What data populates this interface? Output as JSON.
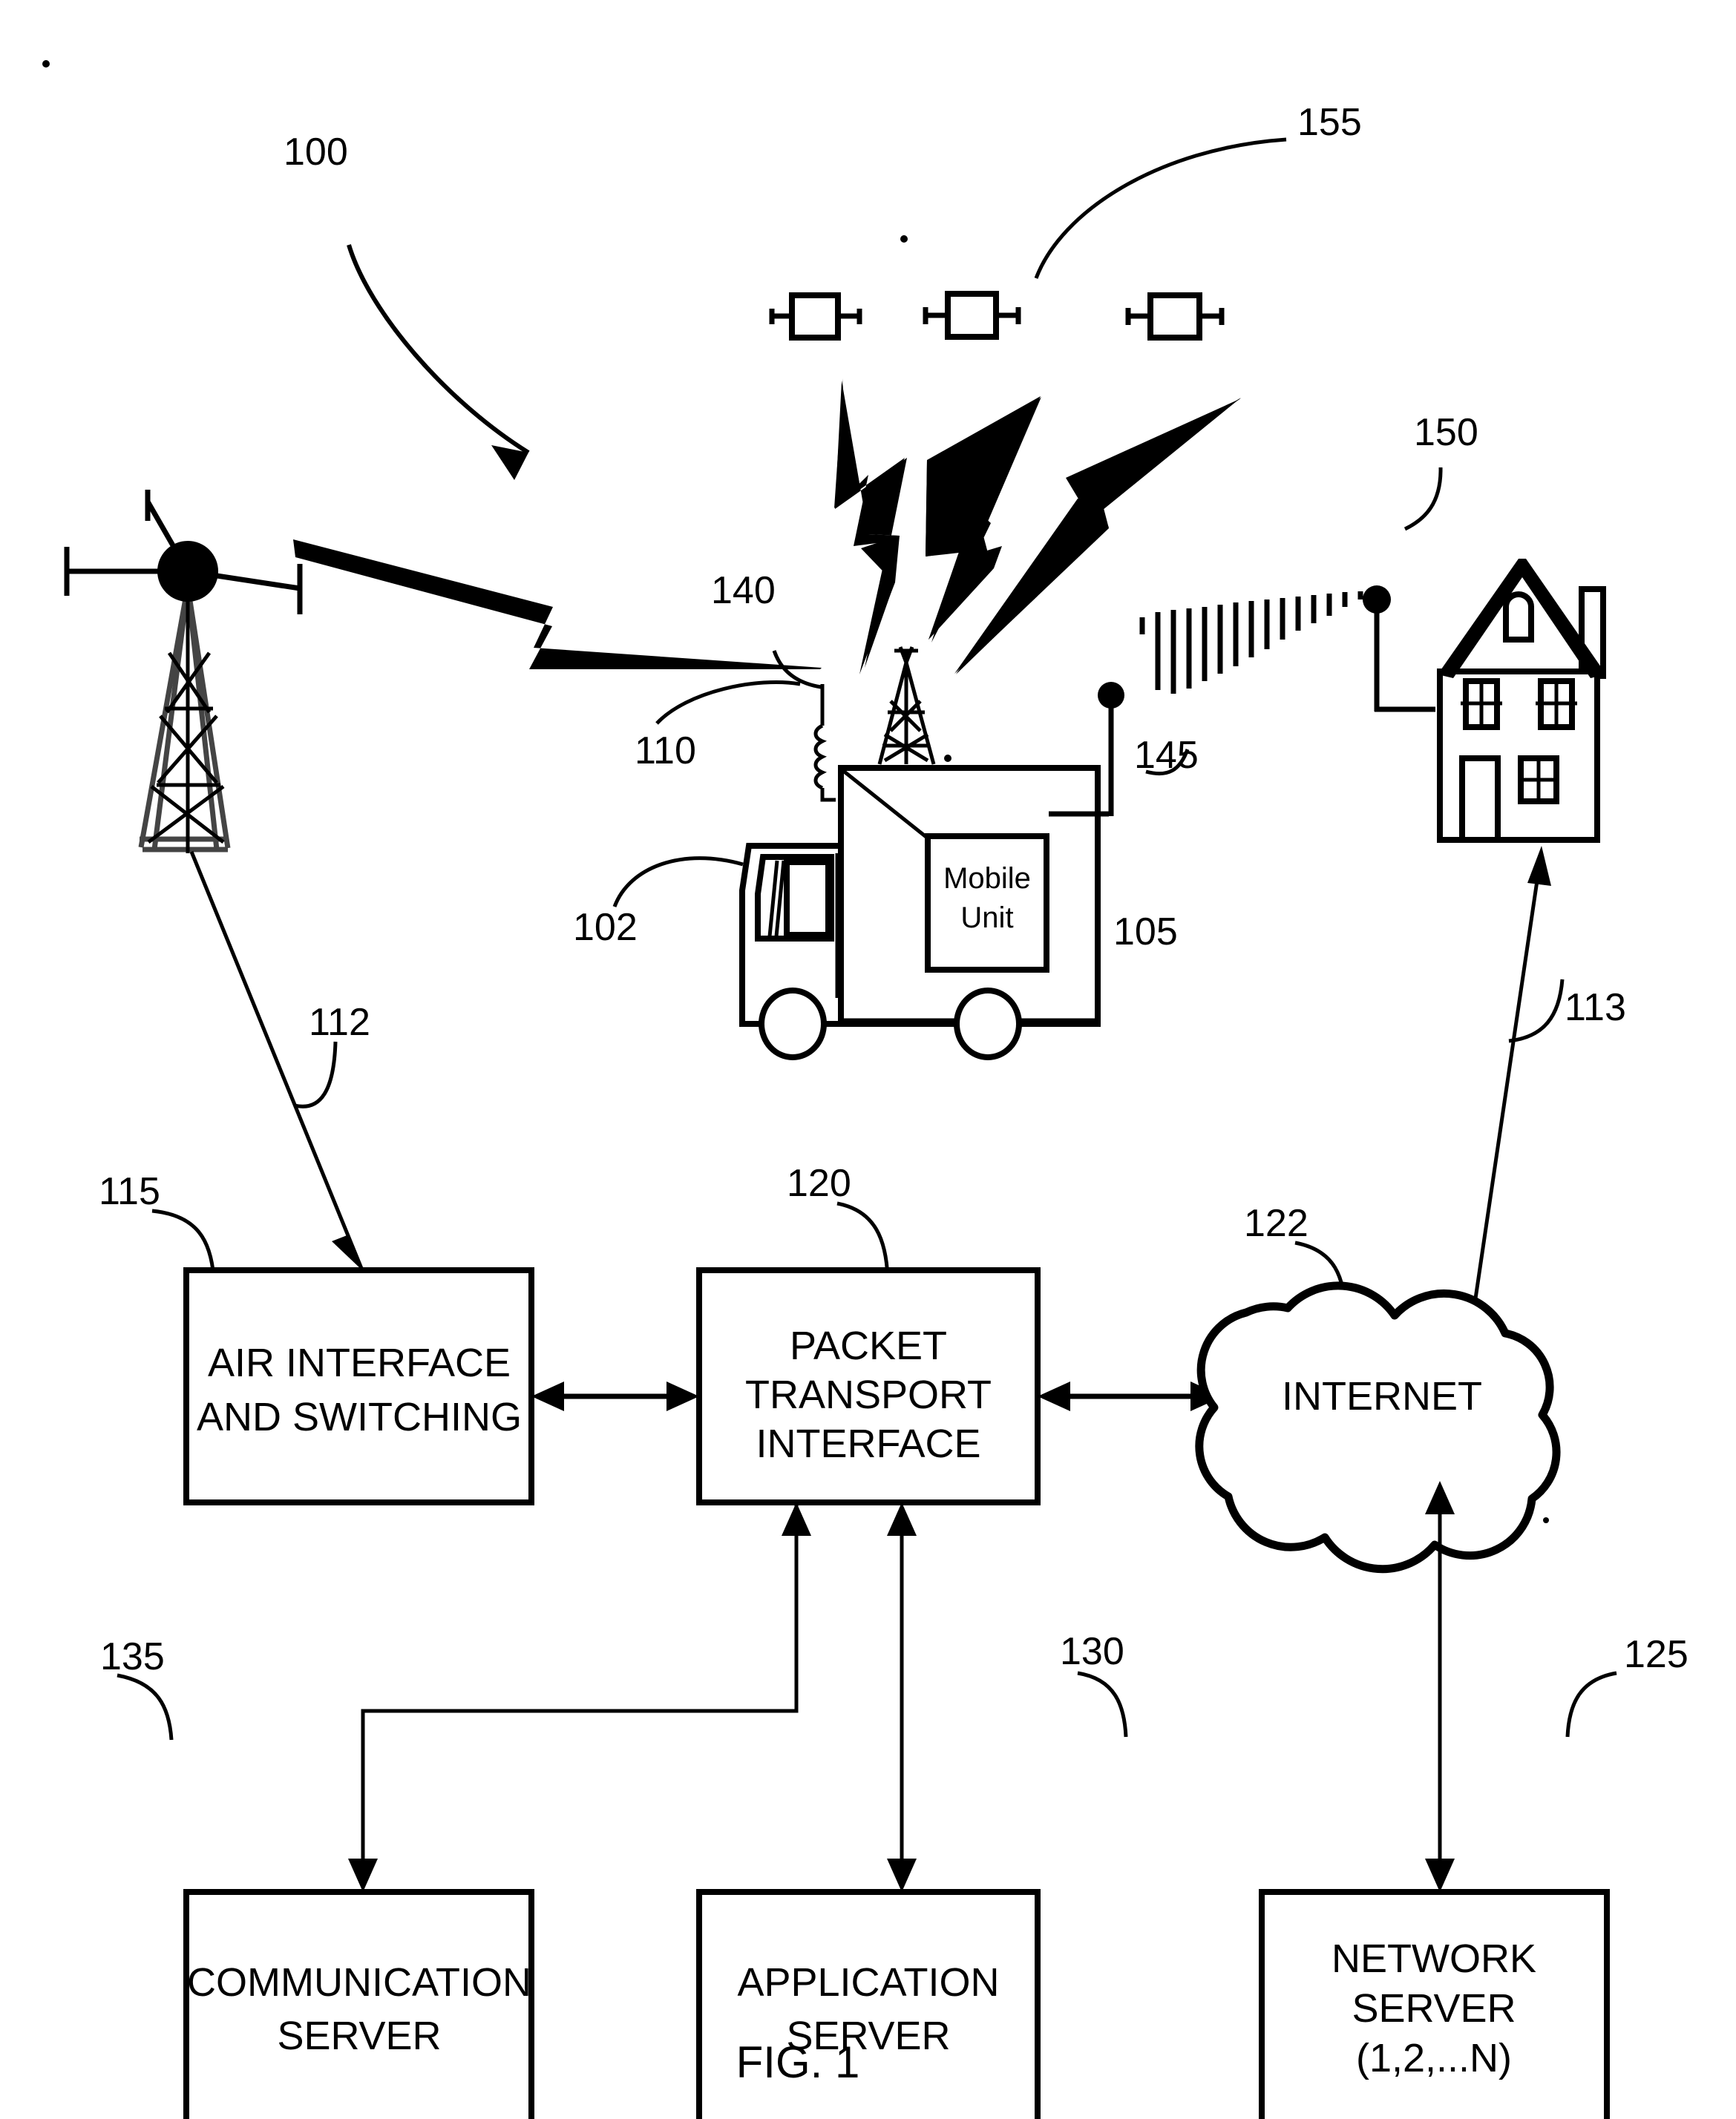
{
  "figure": {
    "caption": "FIG. 1",
    "system_ref": "100"
  },
  "reference_numbers": {
    "system": "100",
    "truck": "102",
    "mobile_unit": "105",
    "mast_antenna": "110",
    "backhaul_link": "112",
    "internet_link": "113",
    "rf_link_tower": "140",
    "rf_beam_house": "145",
    "house": "150",
    "satellites": "155",
    "air_interface": "115",
    "packet_transport": "120",
    "internet_cloud": "122",
    "network_server": "125",
    "application_server": "130",
    "communication_server": "135"
  },
  "nodes": {
    "air_interface": {
      "ref": "115",
      "lines": [
        "AIR INTERFACE",
        "AND SWITCHING"
      ]
    },
    "packet_transport": {
      "ref": "120",
      "lines": [
        "PACKET",
        "TRANSPORT",
        "INTERFACE"
      ]
    },
    "internet": {
      "ref": "122",
      "lines": [
        "INTERNET"
      ]
    },
    "communication_server": {
      "ref": "135",
      "lines": [
        "COMMUNICATION",
        "SERVER"
      ]
    },
    "application_server": {
      "ref": "130",
      "lines": [
        "APPLICATION",
        "SERVER"
      ]
    },
    "network_server": {
      "ref": "125",
      "lines": [
        "NETWORK",
        "SERVER",
        "(1,2,...N)"
      ]
    },
    "mobile_unit": {
      "ref": "105",
      "lines": [
        "Mobile",
        "Unit"
      ]
    }
  },
  "pictograms": {
    "cell_tower": "cell-tower-icon",
    "truck": "truck-icon",
    "mast": "mast-antenna-icon",
    "satellites": [
      "satellite-icon",
      "satellite-icon",
      "satellite-icon"
    ],
    "house": "house-icon",
    "lightning_bolts": [
      "lightning-bolt-icon",
      "lightning-bolt-icon",
      "lightning-bolt-icon",
      "lightning-bolt-icon"
    ],
    "rf_beam": "rf-beam-icon",
    "cloud": "cloud-icon"
  },
  "colors": {
    "ink": "#000000",
    "paper": "#ffffff",
    "tower_fill": "#444444"
  }
}
